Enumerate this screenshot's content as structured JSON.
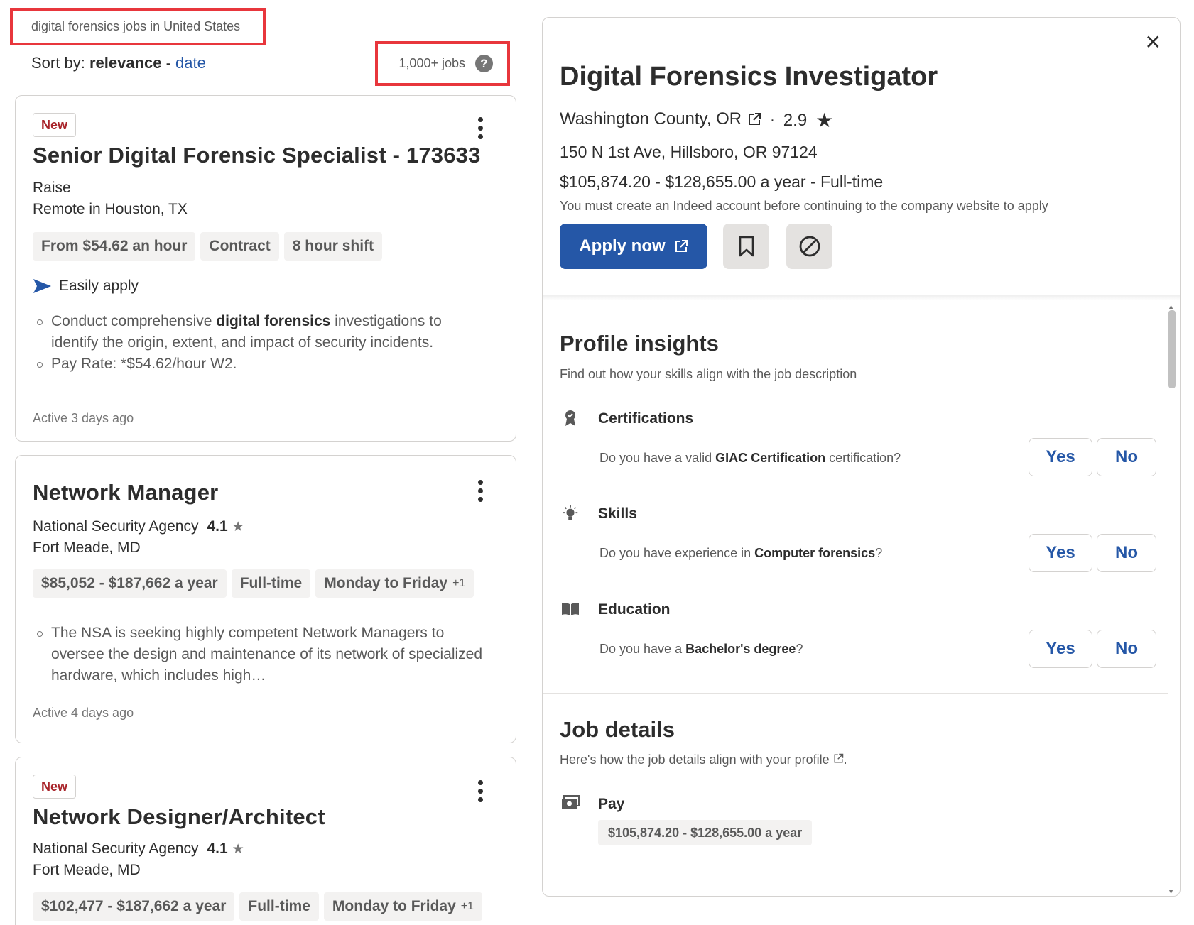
{
  "search": {
    "summary": "digital forensics jobs in United States",
    "sort_prefix": "Sort by:",
    "sort_current": "relevance",
    "sort_sep": "-",
    "sort_alt": "date",
    "job_count": "1,000+ jobs",
    "help_glyph": "?"
  },
  "cards": [
    {
      "badge": "New",
      "title": "Senior Digital Forensic Specialist - 173633",
      "company": "Raise",
      "location": "Remote in Houston, TX",
      "tags": [
        "From $54.62 an hour",
        "Contract",
        "8 hour shift"
      ],
      "easily_apply": "Easily apply",
      "snippet_1_pre": "Conduct comprehensive ",
      "snippet_1_bold": "digital forensics",
      "snippet_1_post": " investigations to identify the origin, extent, and impact of security incidents.",
      "snippet_2": "Pay Rate: *$54.62/hour W2.",
      "active": "Active 3 days ago"
    },
    {
      "title": "Network Manager",
      "company": "National Security Agency",
      "rating": "4.1",
      "location": "Fort Meade, MD",
      "tags": [
        "$85,052 - $187,662 a year",
        "Full-time",
        "Monday to Friday"
      ],
      "tag_more": "+1",
      "snippet": "The NSA is seeking highly competent Network Managers to oversee the design and maintenance of its network of specialized hardware, which includes high…",
      "active": "Active 4 days ago"
    },
    {
      "badge": "New",
      "title": "Network Designer/Architect",
      "company": "National Security Agency",
      "rating": "4.1",
      "location": "Fort Meade, MD",
      "tags": [
        "$102,477 - $187,662 a year",
        "Full-time",
        "Monday to Friday"
      ],
      "tag_more": "+1"
    }
  ],
  "detail": {
    "title": "Digital Forensics Investigator",
    "company": "Washington County, OR",
    "rating_sep": "·",
    "rating": "2.9",
    "address": "150 N 1st Ave, Hillsboro, OR 97124",
    "salary": "$105,874.20 - $128,655.00 a year  - Full-time",
    "note": "You must create an Indeed account before continuing to the company website to apply",
    "apply_label": "Apply now",
    "profile_insights": {
      "title": "Profile insights",
      "subtitle": "Find out how your skills align with the job description",
      "rows": [
        {
          "label": "Certifications",
          "q_pre": "Do you have a valid ",
          "q_bold": "GIAC Certification",
          "q_post": " certification?"
        },
        {
          "label": "Skills",
          "q_pre": "Do you have experience in ",
          "q_bold": "Computer forensics",
          "q_post": "?"
        },
        {
          "label": "Education",
          "q_pre": "Do you have a ",
          "q_bold": "Bachelor's degree",
          "q_post": "?"
        }
      ],
      "yes_label": "Yes",
      "no_label": "No"
    },
    "job_details": {
      "title": "Job details",
      "subtitle_pre": "Here's how the job details align with your ",
      "subtitle_link": "profile",
      "subtitle_post": ".",
      "pay_label": "Pay",
      "pay_value": "$105,874.20 - $128,655.00 a year"
    }
  },
  "colors": {
    "accent_blue": "#2557a7",
    "highlight_red": "#e8363c",
    "new_badge": "#a9252b"
  }
}
